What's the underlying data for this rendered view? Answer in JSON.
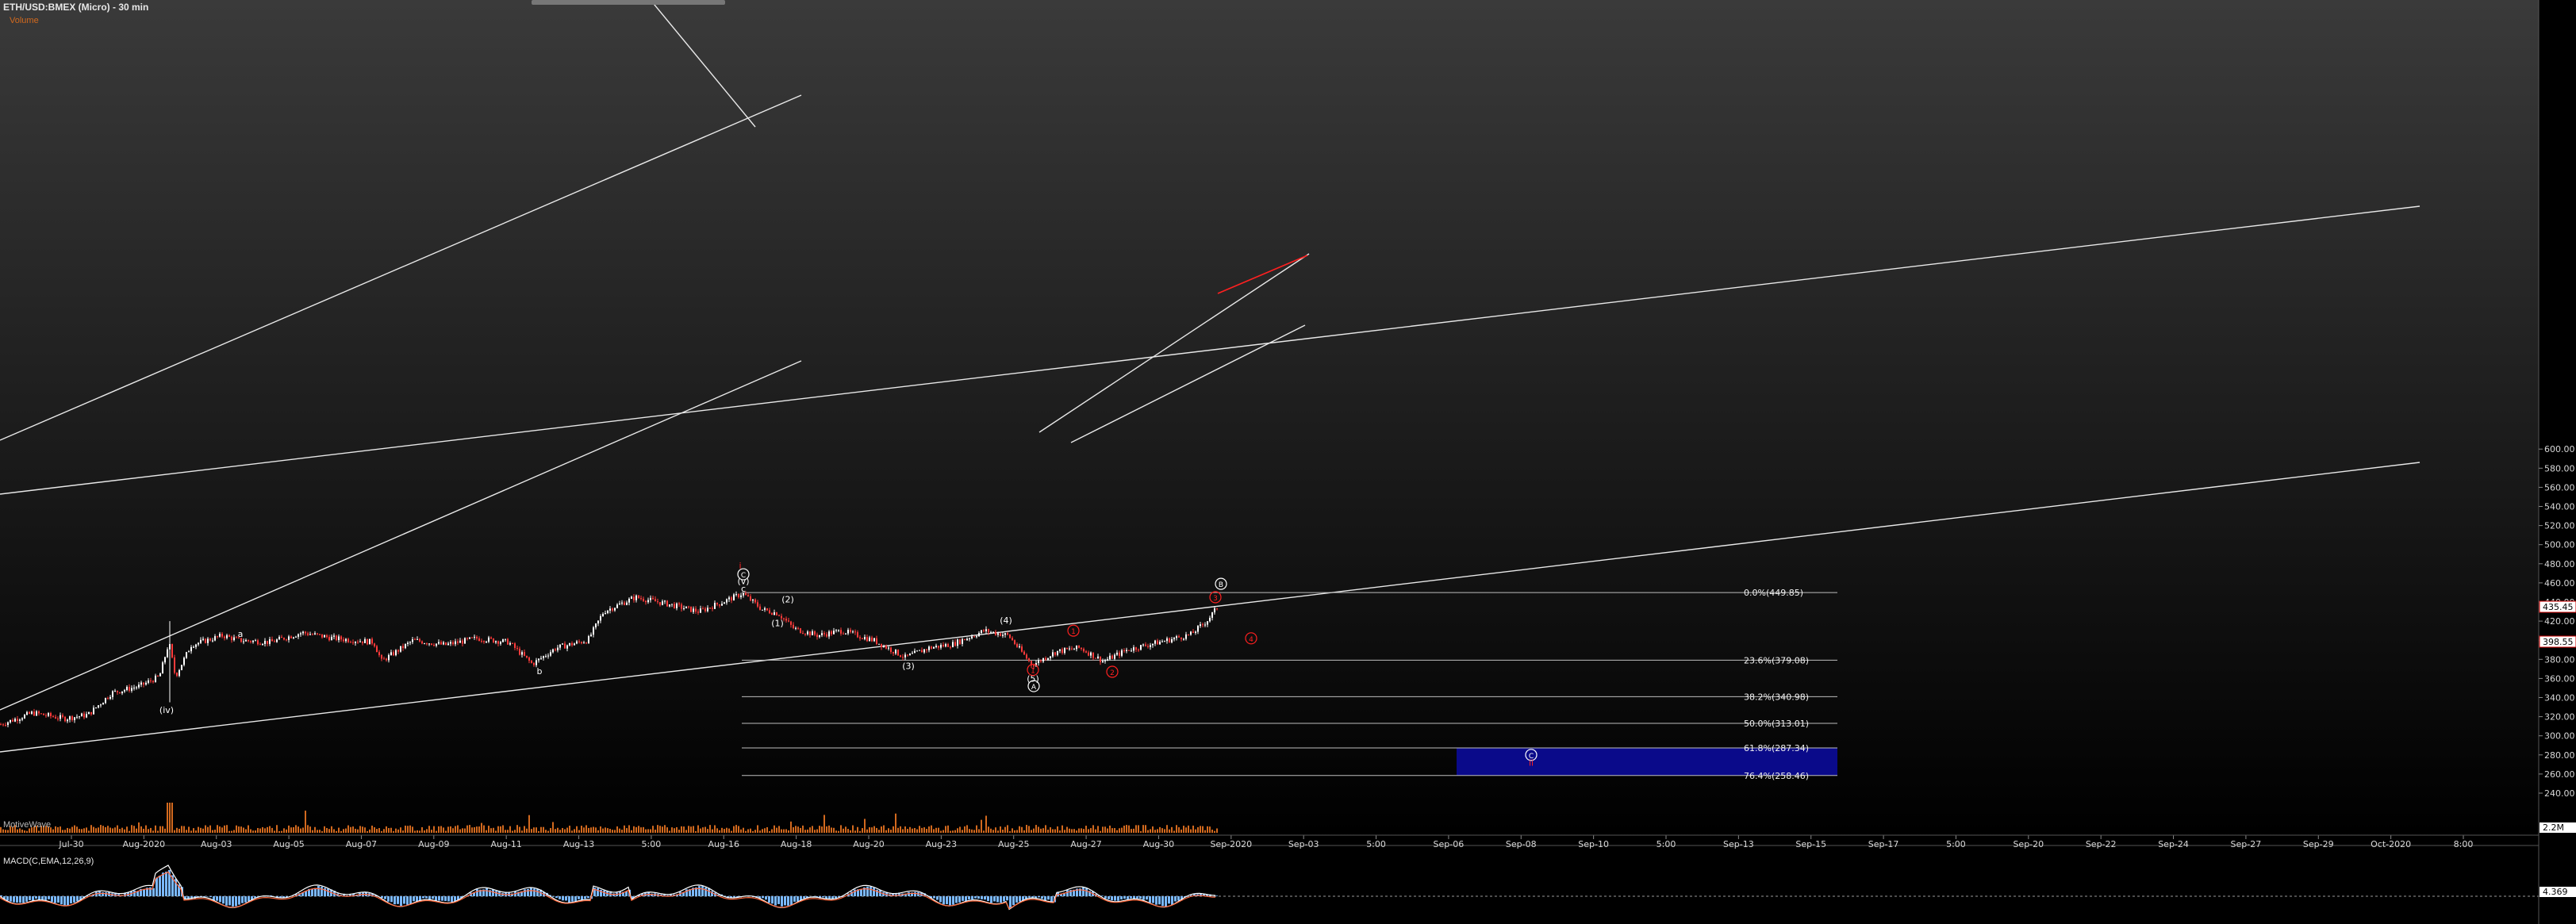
{
  "header": {
    "title": "ETH/USD:BMEX (Micro) - 30 min",
    "volume_label": "Volume",
    "macd_label": "MACD(C,EMA,12,26,9)",
    "motive_label": "MotiveWave"
  },
  "colors": {
    "background_top": "#3a3a3a",
    "background_bottom": "#000000",
    "up_candle": "#ffffff",
    "down_candle": "#ff3b3b",
    "volume": "#d2691e",
    "target_box": "#0a0a8a",
    "wave_red": "#ff2020",
    "macd_line": "#ffffff",
    "signal_line": "#ff6a3d",
    "histogram": "#7ab8ff"
  },
  "chart_data": {
    "type": "candlestick",
    "title": "ETH/USD:BMEX (Micro) - 30 min",
    "ylim": [
      220,
      610
    ],
    "y_ticks": [
      "240.00",
      "260.00",
      "280.00",
      "300.00",
      "320.00",
      "340.00",
      "360.00",
      "380.00",
      "400.00",
      "420.00",
      "440.00",
      "460.00",
      "480.00",
      "500.00",
      "520.00",
      "540.00",
      "560.00",
      "580.00",
      "600.00"
    ],
    "x_ticks": [
      "Jul-30",
      "Aug-2020",
      "Aug-03",
      "Aug-05",
      "Aug-07",
      "Aug-09",
      "Aug-11",
      "Aug-13",
      "5:00",
      "Aug-16",
      "Aug-18",
      "Aug-20",
      "Aug-23",
      "Aug-25",
      "Aug-27",
      "Aug-30",
      "Sep-2020",
      "Sep-03",
      "5:00",
      "Sep-06",
      "Sep-08",
      "Sep-10",
      "5:00",
      "Sep-13",
      "Sep-15",
      "Sep-17",
      "5:00",
      "Sep-20",
      "Sep-22",
      "Sep-24",
      "Sep-27",
      "Sep-29",
      "Oct-2020",
      "8:00"
    ],
    "price_path": [
      {
        "x": 0,
        "y": 312
      },
      {
        "x": 40,
        "y": 324
      },
      {
        "x": 80,
        "y": 318
      },
      {
        "x": 110,
        "y": 322
      },
      {
        "x": 140,
        "y": 345
      },
      {
        "x": 175,
        "y": 352
      },
      {
        "x": 200,
        "y": 362
      },
      {
        "x": 212,
        "y": 398
      },
      {
        "x": 220,
        "y": 362
      },
      {
        "x": 240,
        "y": 395
      },
      {
        "x": 280,
        "y": 405
      },
      {
        "x": 300,
        "y": 400
      },
      {
        "x": 340,
        "y": 398
      },
      {
        "x": 380,
        "y": 408
      },
      {
        "x": 420,
        "y": 402
      },
      {
        "x": 470,
        "y": 398
      },
      {
        "x": 480,
        "y": 378
      },
      {
        "x": 520,
        "y": 400
      },
      {
        "x": 560,
        "y": 395
      },
      {
        "x": 600,
        "y": 402
      },
      {
        "x": 640,
        "y": 398
      },
      {
        "x": 670,
        "y": 375
      },
      {
        "x": 700,
        "y": 392
      },
      {
        "x": 740,
        "y": 400
      },
      {
        "x": 760,
        "y": 430
      },
      {
        "x": 800,
        "y": 445
      },
      {
        "x": 840,
        "y": 438
      },
      {
        "x": 880,
        "y": 430
      },
      {
        "x": 910,
        "y": 440
      },
      {
        "x": 935,
        "y": 449
      },
      {
        "x": 960,
        "y": 432
      },
      {
        "x": 980,
        "y": 428
      },
      {
        "x": 1000,
        "y": 412
      },
      {
        "x": 1030,
        "y": 405
      },
      {
        "x": 1060,
        "y": 410
      },
      {
        "x": 1100,
        "y": 400
      },
      {
        "x": 1140,
        "y": 382
      },
      {
        "x": 1170,
        "y": 392
      },
      {
        "x": 1200,
        "y": 396
      },
      {
        "x": 1240,
        "y": 410
      },
      {
        "x": 1270,
        "y": 405
      },
      {
        "x": 1300,
        "y": 374
      },
      {
        "x": 1330,
        "y": 388
      },
      {
        "x": 1360,
        "y": 392
      },
      {
        "x": 1390,
        "y": 378
      },
      {
        "x": 1420,
        "y": 390
      },
      {
        "x": 1460,
        "y": 398
      },
      {
        "x": 1500,
        "y": 406
      },
      {
        "x": 1520,
        "y": 420
      },
      {
        "x": 1535,
        "y": 436
      }
    ],
    "fib_levels": [
      {
        "label": "0.0%(449.85)",
        "value": 449.85
      },
      {
        "label": "23.6%(379.08)",
        "value": 379.08
      },
      {
        "label": "38.2%(340.98)",
        "value": 340.98
      },
      {
        "label": "50.0%(313.01)",
        "value": 313.01
      },
      {
        "label": "61.8%(287.34)",
        "value": 287.34
      },
      {
        "label": "76.4%(258.46)",
        "value": 258.46
      }
    ],
    "price_badges": [
      {
        "label": "435.45",
        "value": 435
      },
      {
        "label": "398.55",
        "value": 398.5
      }
    ],
    "wave_labels": [
      {
        "text": "(iv)",
        "x": 210,
        "y": 327,
        "color": "white"
      },
      {
        "text": "a",
        "x": 303,
        "y": 407,
        "color": "white"
      },
      {
        "text": "b",
        "x": 680,
        "y": 368,
        "color": "white"
      },
      {
        "text": "i",
        "x": 933,
        "y": 478,
        "color": "red"
      },
      {
        "text": "c",
        "x": 937,
        "y": 454,
        "color": "white"
      },
      {
        "text": "(v)",
        "x": 937,
        "y": 462,
        "color": "white"
      },
      {
        "text": "C",
        "x": 937,
        "y": 469,
        "color": "white",
        "circled": true
      },
      {
        "text": "(1)",
        "x": 980,
        "y": 418,
        "color": "white"
      },
      {
        "text": "(2)",
        "x": 993,
        "y": 443,
        "color": "white"
      },
      {
        "text": "(3)",
        "x": 1145,
        "y": 373,
        "color": "white"
      },
      {
        "text": "(4)",
        "x": 1268,
        "y": 421,
        "color": "white"
      },
      {
        "text": "(5)",
        "x": 1302,
        "y": 360,
        "color": "white"
      },
      {
        "text": "A",
        "x": 1303,
        "y": 352,
        "color": "white",
        "circled": true
      },
      {
        "text": "1",
        "x": 1302,
        "y": 369,
        "color": "red",
        "circled": true
      },
      {
        "text": "1",
        "x": 1353,
        "y": 410,
        "color": "red",
        "circled": true
      },
      {
        "text": "2",
        "x": 1402,
        "y": 367,
        "color": "red",
        "circled": true
      },
      {
        "text": "3",
        "x": 1532,
        "y": 445,
        "color": "red",
        "circled": true
      },
      {
        "text": "4",
        "x": 1577,
        "y": 402,
        "color": "red",
        "circled": true
      },
      {
        "text": "B",
        "x": 1539,
        "y": 459,
        "color": "white",
        "circled": true
      },
      {
        "text": "C",
        "x": 1930,
        "y": 280,
        "color": "white",
        "circled": true
      },
      {
        "text": "ii",
        "x": 1930,
        "y": 272,
        "color": "red"
      }
    ],
    "macd_zero_label": "4.369",
    "volume_badge": "2.2M",
    "grid": false,
    "legend": "none"
  }
}
